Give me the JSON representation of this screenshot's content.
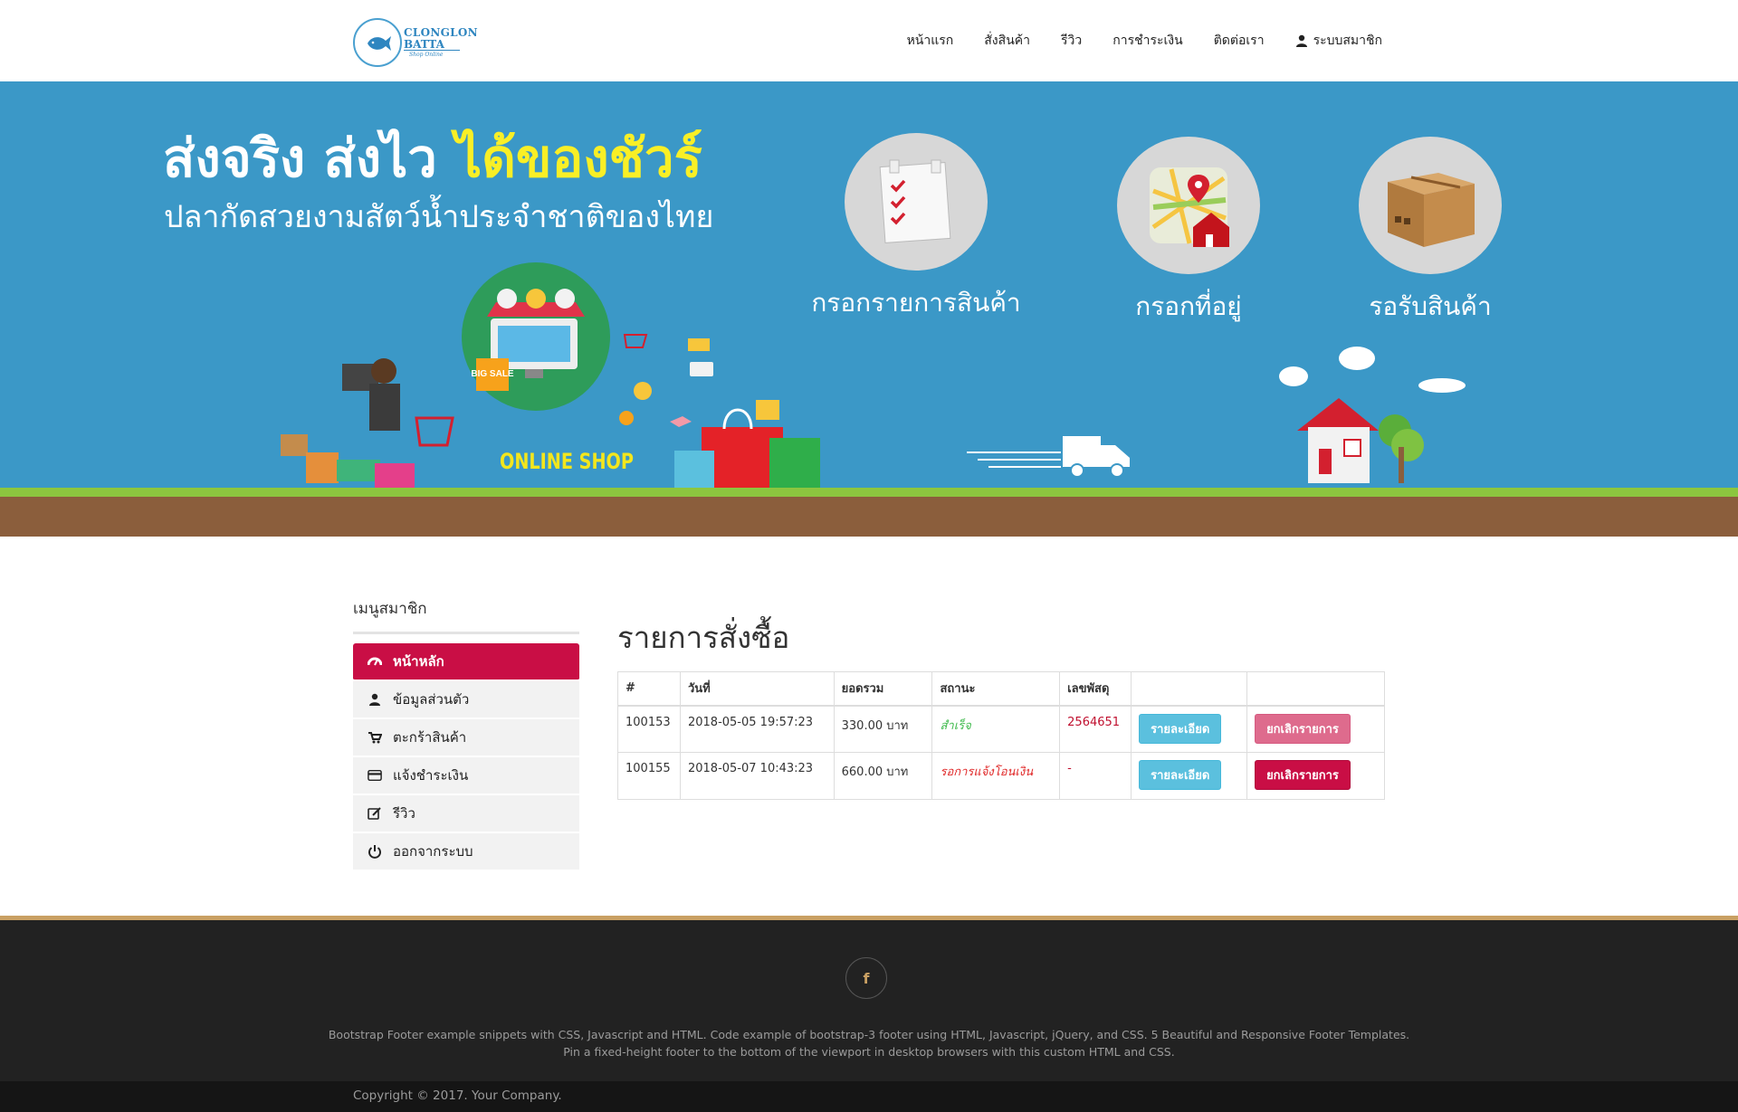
{
  "brand": {
    "line1": "CLONGLON",
    "line2": "BATTA",
    "tagline": "Shop Online",
    "seal_text": "BATTA"
  },
  "nav": {
    "items": [
      {
        "label": "หน้าแรก"
      },
      {
        "label": "สั่งสินค้า"
      },
      {
        "label": "รีวิว"
      },
      {
        "label": "การชำระเงิน"
      },
      {
        "label": "ติดต่อเรา"
      },
      {
        "label": "ระบบสมาชิก",
        "icon": "user-icon"
      }
    ]
  },
  "hero": {
    "title_part1": "ส่งจริง ส่งไว ",
    "title_part2": "ได้ของชัวร์",
    "subtitle": "ปลากัดสวยงามสัตว์น้ำประจำชาติของไทย",
    "steps": [
      {
        "label": "กรอกรายการสินค้า",
        "icon": "checklist-icon"
      },
      {
        "label": "กรอกที่อยู่",
        "icon": "map-pin-icon"
      },
      {
        "label": "รอรับสินค้า",
        "icon": "box-icon"
      }
    ],
    "online_shop": "ONLINE SHOP",
    "big_sale": "BIG SALE",
    "slides": 2,
    "active_slide": 1,
    "colors": {
      "sky": "#3b98c7",
      "grass": "#8cc63f",
      "ground": "#8b5e3c",
      "highlight": "#f9ef26"
    }
  },
  "sidebar": {
    "title": "เมนูสมาชิก",
    "items": [
      {
        "label": "หน้าหลัก",
        "icon": "dashboard-icon",
        "active": true
      },
      {
        "label": "ข้อมูลส่วนตัว",
        "icon": "user-icon"
      },
      {
        "label": "ตะกร้าสินค้า",
        "icon": "cart-icon"
      },
      {
        "label": "แจ้งชำระเงิน",
        "icon": "credit-card-icon"
      },
      {
        "label": "รีวิว",
        "icon": "edit-icon"
      },
      {
        "label": "ออกจากระบบ",
        "icon": "power-icon"
      }
    ]
  },
  "orders": {
    "title": "รายการสั่งซื้อ",
    "columns": [
      "#",
      "วันที่",
      "ยอดรวม",
      "สถานะ",
      "เลขพัสดุ",
      "",
      ""
    ],
    "rows": [
      {
        "id": "100153",
        "date": "2018-05-05 19:57:23",
        "total": "330.00 บาท",
        "status": "สำเร็จ",
        "tracking": "2564651",
        "detail_btn": "รายละเอียด",
        "cancel_btn": "ยกเลิกรายการ",
        "cancel_enabled": false
      },
      {
        "id": "100155",
        "date": "2018-05-07 10:43:23",
        "total": "660.00 บาท",
        "status": "รอการแจ้งโอนเงิน",
        "tracking": "-",
        "detail_btn": "รายละเอียด",
        "cancel_btn": "ยกเลิกรายการ",
        "cancel_enabled": true
      }
    ]
  },
  "footer": {
    "social_icon": "facebook-icon",
    "social_glyph": "f",
    "text_line1": "Bootstrap Footer example snippets with CSS, Javascript and HTML. Code example of bootstrap-3 footer using HTML, Javascript, jQuery, and CSS. 5 Beautiful and Responsive Footer Templates.",
    "text_line2": "Pin a fixed-height footer to the bottom of the viewport in desktop browsers with this custom HTML and CSS.",
    "copyright": "Copyright © 2017. Your Company."
  }
}
